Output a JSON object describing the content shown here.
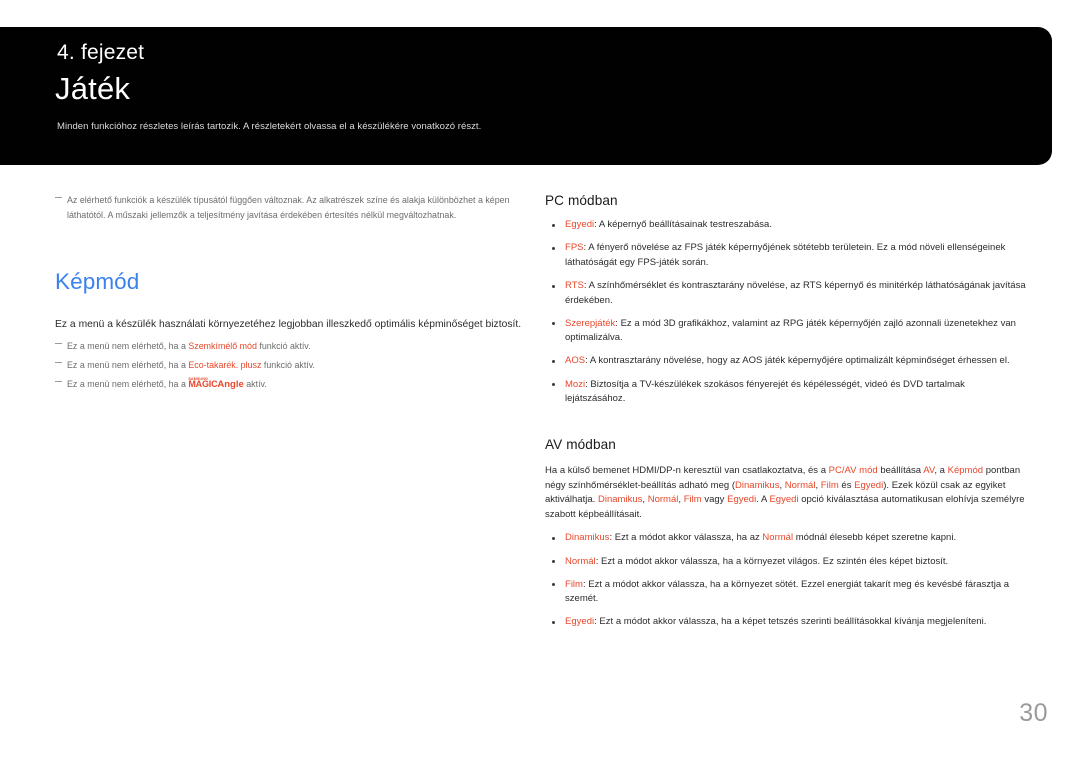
{
  "header": {
    "chapter_label": "4. fejezet",
    "chapter_title": "Játék",
    "chapter_subtitle": "Minden funkcióhoz részletes leírás tartozik. A részletekért olvassa el a készülékére vonatkozó részt."
  },
  "colors": {
    "accent_red": "#e8472a",
    "heading_blue": "#3a82ec",
    "band_black": "#010101",
    "page_number_gray": "#9b9b9b"
  },
  "left": {
    "intro_note": "Az elérhető funkciók a készülék típusától függően változnak. Az alkatrészek színe és alakja különbözhet a képen láthatótól. A műszaki jellemzők a teljesítmény javítása érdekében értesítés nélkül megváltozhatnak.",
    "section_heading": "Képmód",
    "lead": "Ez a menü a készülék használati környezetéhez legjobban illeszkedő optimális képminőséget biztosít.",
    "notes": [
      {
        "pre": "Ez a menü nem elérhető, ha a ",
        "term": "Szemkímélő mód",
        "post": " funkció aktív."
      },
      {
        "pre": "Ez a menü nem elérhető, ha a ",
        "term": "Eco-takarék. plusz",
        "post": " funkció aktív."
      }
    ],
    "magic_note": {
      "pre": "Ez a menü nem elérhető, ha a ",
      "brand_small": "SAMSUNG",
      "brand_magic": "MAGIC",
      "brand_angle": "Angle",
      "post": " aktív."
    }
  },
  "right": {
    "pc_heading": "PC módban",
    "pc_bullets": [
      {
        "term": "Egyedi",
        "text": ": A képernyő beállításainak testreszabása."
      },
      {
        "term": "FPS",
        "text": ": A fényerő növelése az FPS játék képernyőjének sötétebb területein. Ez a mód növeli ellenségeinek láthatóságát egy FPS-játék során."
      },
      {
        "term": "RTS",
        "text": ": A színhőmérséklet és kontrasztarány növelése, az RTS képernyő és minitérkép láthatóságának javítása érdekében."
      },
      {
        "term": "Szerepjáték",
        "text": ": Ez a mód 3D grafikákhoz, valamint az RPG játék képernyőjén zajló azonnali üzenetekhez van optimalizálva."
      },
      {
        "term": "AOS",
        "text": ": A kontrasztarány növelése, hogy az AOS játék képernyőjére optimalizált képminőséget érhessen el."
      },
      {
        "term": "Mozi",
        "text": ": Biztosítja a TV-készülékek szokásos fényerejét és képélességét, videó és DVD tartalmak lejátszásához."
      }
    ],
    "av_heading": "AV módban",
    "av_paragraph": {
      "p1": "Ha a külső bemenet HDMI/DP-n keresztül van csatlakoztatva, és a ",
      "t1": "PC/AV mód",
      "p2": " beállítása ",
      "t2": "AV",
      "p3": ", a ",
      "t3": "Képmód",
      "p4": " pontban négy színhőmérséklet-beállítás adható meg (",
      "t4": "Dinamikus",
      "p5": ", ",
      "t5": "Normál",
      "p6": ", ",
      "t6": "Film",
      "p7": " és ",
      "t7": "Egyedi",
      "p8": "). Ezek közül csak az egyiket aktiválhatja. ",
      "t8": "Dinamikus",
      "p9": ", ",
      "t9": "Normál",
      "p10": ", ",
      "t10": "Film",
      "p11": " vagy ",
      "t11": "Egyedi",
      "p12": ". A ",
      "t12": "Egyedi",
      "p13": " opció kiválasztása automatikusan elohívja személyre szabott képbeállításait."
    },
    "av_bullets": [
      {
        "term": "Dinamikus",
        "text_a": ": Ezt a módot akkor válassza, ha az ",
        "term2": "Normál",
        "text_b": " módnál élesebb képet szeretne kapni."
      },
      {
        "term": "Normál",
        "text_a": ": Ezt a módot akkor válassza, ha a környezet világos. Ez szintén éles képet biztosít.",
        "term2": "",
        "text_b": ""
      },
      {
        "term": "Film",
        "text_a": ": Ezt a módot akkor válassza, ha a környezet sötét. Ezzel energiát takarít meg és kevésbé fárasztja a szemét.",
        "term2": "",
        "text_b": ""
      },
      {
        "term": "Egyedi",
        "text_a": ": Ezt a módot akkor válassza, ha a képet tetszés szerinti beállításokkal kívánja megjeleníteni.",
        "term2": "",
        "text_b": ""
      }
    ]
  },
  "footer": {
    "page_number": "30"
  }
}
